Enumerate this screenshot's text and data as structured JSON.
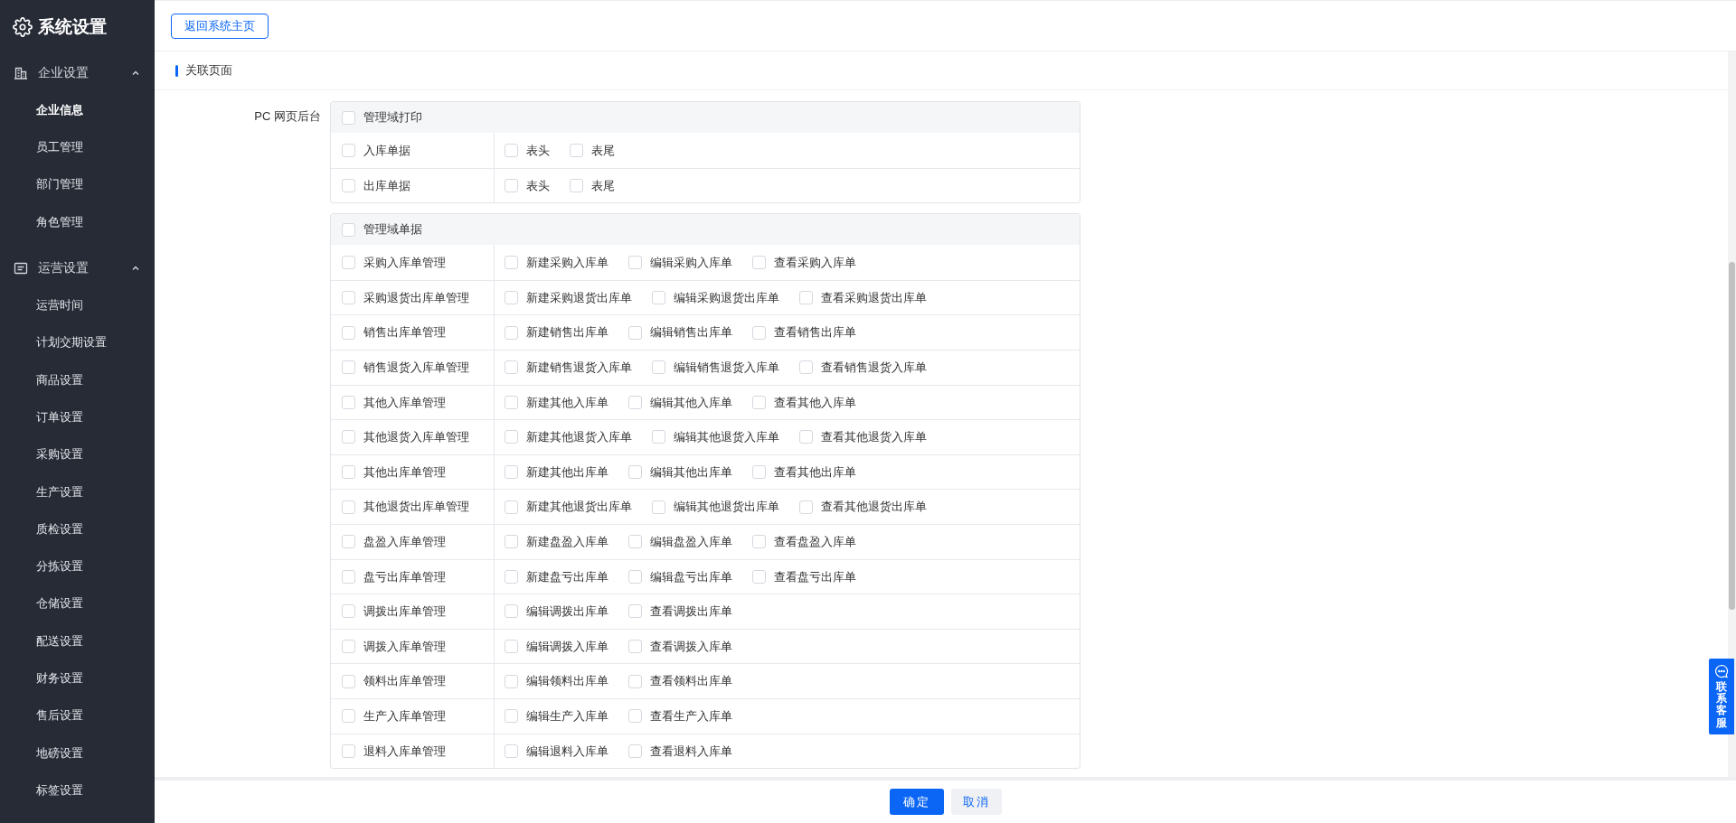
{
  "sidebar": {
    "title": "系统设置",
    "groups": [
      {
        "label": "企业设置",
        "expanded": true,
        "items": [
          {
            "label": "企业信息",
            "selected": true
          },
          {
            "label": "员工管理",
            "selected": false
          },
          {
            "label": "部门管理",
            "selected": false
          },
          {
            "label": "角色管理",
            "selected": false
          }
        ]
      },
      {
        "label": "运营设置",
        "expanded": true,
        "items": [
          {
            "label": "运营时间",
            "selected": false
          },
          {
            "label": "计划交期设置",
            "selected": false
          },
          {
            "label": "商品设置",
            "selected": false
          },
          {
            "label": "订单设置",
            "selected": false
          },
          {
            "label": "采购设置",
            "selected": false
          },
          {
            "label": "生产设置",
            "selected": false
          },
          {
            "label": "质检设置",
            "selected": false
          },
          {
            "label": "分拣设置",
            "selected": false
          },
          {
            "label": "仓储设置",
            "selected": false
          },
          {
            "label": "配送设置",
            "selected": false
          },
          {
            "label": "财务设置",
            "selected": false
          },
          {
            "label": "售后设置",
            "selected": false
          },
          {
            "label": "地磅设置",
            "selected": false
          },
          {
            "label": "标签设置",
            "selected": false
          }
        ]
      }
    ]
  },
  "top_bar": {
    "back_button": "返回系统主页"
  },
  "section": {
    "title": "关联页面",
    "field_label": "PC 网页后台",
    "groups": [
      {
        "label": "管理域打印",
        "checked": false,
        "rows": [
          {
            "label": "入库单据",
            "checked": false,
            "options": [
              {
                "label": "表头",
                "checked": false
              },
              {
                "label": "表尾",
                "checked": false
              }
            ]
          },
          {
            "label": "出库单据",
            "checked": false,
            "options": [
              {
                "label": "表头",
                "checked": false
              },
              {
                "label": "表尾",
                "checked": false
              }
            ]
          }
        ]
      },
      {
        "label": "管理域单据",
        "checked": false,
        "rows": [
          {
            "label": "采购入库单管理",
            "checked": false,
            "options": [
              {
                "label": "新建采购入库单",
                "checked": false
              },
              {
                "label": "编辑采购入库单",
                "checked": false
              },
              {
                "label": "查看采购入库单",
                "checked": false
              }
            ]
          },
          {
            "label": "采购退货出库单管理",
            "checked": false,
            "options": [
              {
                "label": "新建采购退货出库单",
                "checked": false
              },
              {
                "label": "编辑采购退货出库单",
                "checked": false
              },
              {
                "label": "查看采购退货出库单",
                "checked": false
              }
            ]
          },
          {
            "label": "销售出库单管理",
            "checked": false,
            "options": [
              {
                "label": "新建销售出库单",
                "checked": false
              },
              {
                "label": "编辑销售出库单",
                "checked": false
              },
              {
                "label": "查看销售出库单",
                "checked": false
              }
            ]
          },
          {
            "label": "销售退货入库单管理",
            "checked": false,
            "options": [
              {
                "label": "新建销售退货入库单",
                "checked": false
              },
              {
                "label": "编辑销售退货入库单",
                "checked": false
              },
              {
                "label": "查看销售退货入库单",
                "checked": false
              }
            ]
          },
          {
            "label": "其他入库单管理",
            "checked": false,
            "options": [
              {
                "label": "新建其他入库单",
                "checked": false
              },
              {
                "label": "编辑其他入库单",
                "checked": false
              },
              {
                "label": "查看其他入库单",
                "checked": false
              }
            ]
          },
          {
            "label": "其他退货入库单管理",
            "checked": false,
            "options": [
              {
                "label": "新建其他退货入库单",
                "checked": false
              },
              {
                "label": "编辑其他退货入库单",
                "checked": false
              },
              {
                "label": "查看其他退货入库单",
                "checked": false
              }
            ]
          },
          {
            "label": "其他出库单管理",
            "checked": false,
            "options": [
              {
                "label": "新建其他出库单",
                "checked": false
              },
              {
                "label": "编辑其他出库单",
                "checked": false
              },
              {
                "label": "查看其他出库单",
                "checked": false
              }
            ]
          },
          {
            "label": "其他退货出库单管理",
            "checked": false,
            "options": [
              {
                "label": "新建其他退货出库单",
                "checked": false
              },
              {
                "label": "编辑其他退货出库单",
                "checked": false
              },
              {
                "label": "查看其他退货出库单",
                "checked": false
              }
            ]
          },
          {
            "label": "盘盈入库单管理",
            "checked": false,
            "options": [
              {
                "label": "新建盘盈入库单",
                "checked": false
              },
              {
                "label": "编辑盘盈入库单",
                "checked": false
              },
              {
                "label": "查看盘盈入库单",
                "checked": false
              }
            ]
          },
          {
            "label": "盘亏出库单管理",
            "checked": false,
            "options": [
              {
                "label": "新建盘亏出库单",
                "checked": false
              },
              {
                "label": "编辑盘亏出库单",
                "checked": false
              },
              {
                "label": "查看盘亏出库单",
                "checked": false
              }
            ]
          },
          {
            "label": "调拨出库单管理",
            "checked": false,
            "options": [
              {
                "label": "编辑调拨出库单",
                "checked": false
              },
              {
                "label": "查看调拨出库单",
                "checked": false
              }
            ]
          },
          {
            "label": "调拨入库单管理",
            "checked": false,
            "options": [
              {
                "label": "编辑调拨入库单",
                "checked": false
              },
              {
                "label": "查看调拨入库单",
                "checked": false
              }
            ]
          },
          {
            "label": "领料出库单管理",
            "checked": false,
            "options": [
              {
                "label": "编辑领料出库单",
                "checked": false
              },
              {
                "label": "查看领料出库单",
                "checked": false
              }
            ]
          },
          {
            "label": "生产入库单管理",
            "checked": false,
            "options": [
              {
                "label": "编辑生产入库单",
                "checked": false
              },
              {
                "label": "查看生产入库单",
                "checked": false
              }
            ]
          },
          {
            "label": "退料入库单管理",
            "checked": false,
            "options": [
              {
                "label": "编辑退料入库单",
                "checked": false
              },
              {
                "label": "查看退料入库单",
                "checked": false
              }
            ]
          }
        ]
      }
    ]
  },
  "footer": {
    "confirm": "确定",
    "cancel": "取消"
  },
  "support_button": "联系客服"
}
